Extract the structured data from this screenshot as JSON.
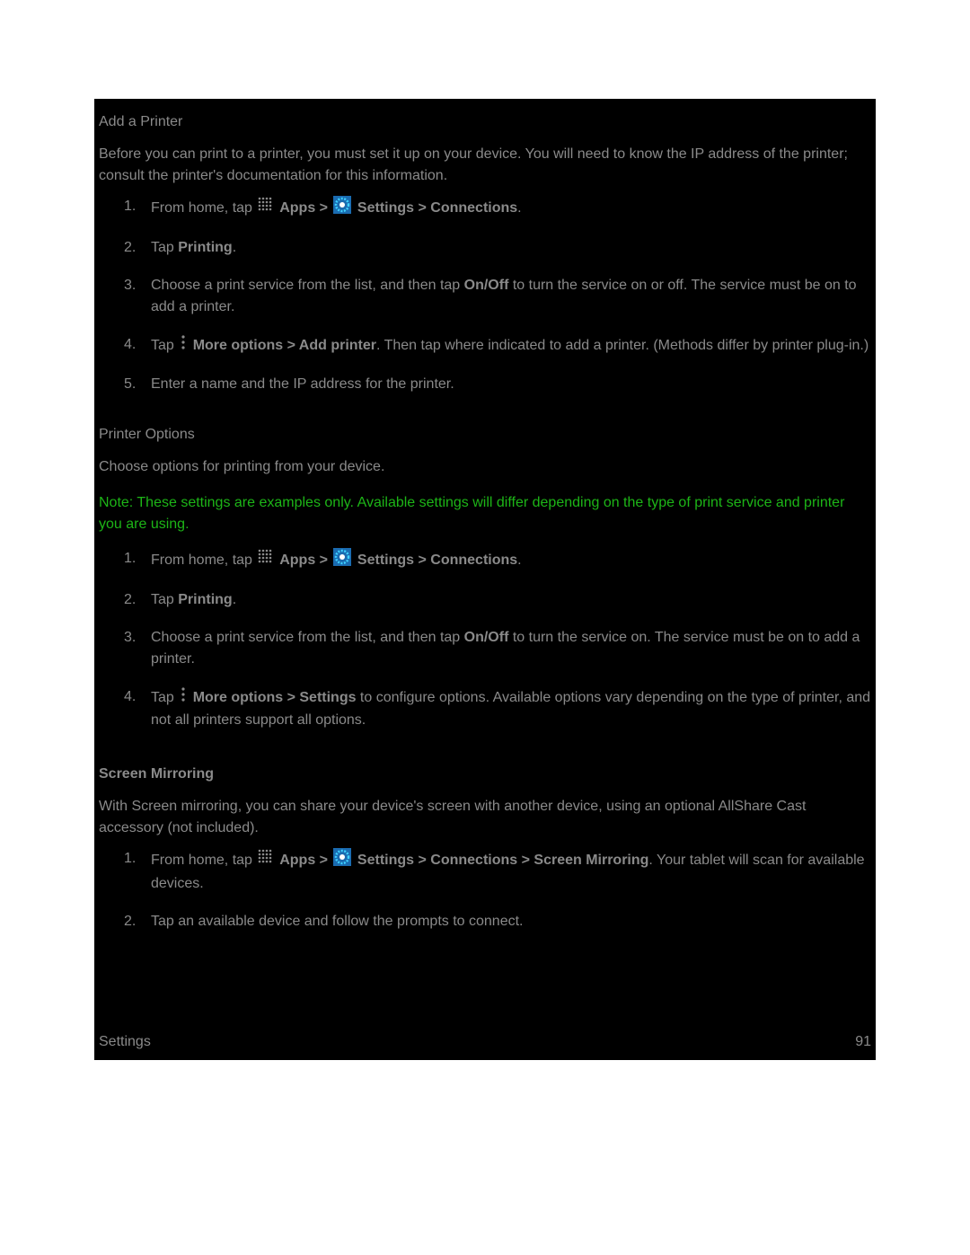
{
  "section1": {
    "heading": "Add a Printer",
    "intro": "Before you can print to a printer, you must set it up on your device. You will need to know the IP address of the printer; consult the printer's documentation for this information.",
    "steps": [
      {
        "prefix": "From home, tap ",
        "apps": " Apps > ",
        "settings": " Settings > Connections",
        "suffix": "."
      },
      {
        "tap": "Tap ",
        "bold": "Printing",
        "suffix": "."
      },
      {
        "text1": "Choose a print service from the list, and then tap ",
        "bold1": "On/Off",
        "text2": " to turn the service on or off. The service must be on to add a printer."
      },
      {
        "text1": "Tap ",
        "bold1": " More options > Add printer",
        "text2": ". Then tap where indicated to add a printer. (Methods differ by printer plug-in.)"
      },
      {
        "text": "Enter a name and the IP address for the printer."
      }
    ]
  },
  "section2": {
    "heading": "Printer Options",
    "intro": "Choose options for printing from your device.",
    "note_label": "Note",
    "note_text": ": These settings are examples only. Available settings will differ depending on the type of print service and printer you are using.",
    "steps": [
      {
        "prefix": "From home, tap ",
        "apps": " Apps > ",
        "settings": " Settings > Connections",
        "suffix": "."
      },
      {
        "tap": "Tap ",
        "bold": "Printing",
        "suffix": "."
      },
      {
        "text1": "Choose a print service from the list, and then tap ",
        "bold1": "On/Off",
        "text2": " to turn the service on. The service must be on to add a printer."
      },
      {
        "text1": "Tap ",
        "bold1": " More options > Settings",
        "text2": " to configure options. Available options vary depending on the type of printer, and not all printers support all options."
      }
    ]
  },
  "section3": {
    "heading": "Screen Mirroring",
    "intro": "With Screen mirroring, you can share your device's screen with another device, using an optional AllShare Cast accessory (not included).",
    "steps": [
      {
        "prefix": "From home, tap ",
        "apps": " Apps > ",
        "settings": " Settings > Connections > Screen Mirroring",
        "suffix": ". Your tablet will scan for available devices."
      },
      {
        "text": "Tap an available device and follow the prompts to connect."
      }
    ]
  },
  "footer": {
    "left": "Settings",
    "right": "91"
  }
}
